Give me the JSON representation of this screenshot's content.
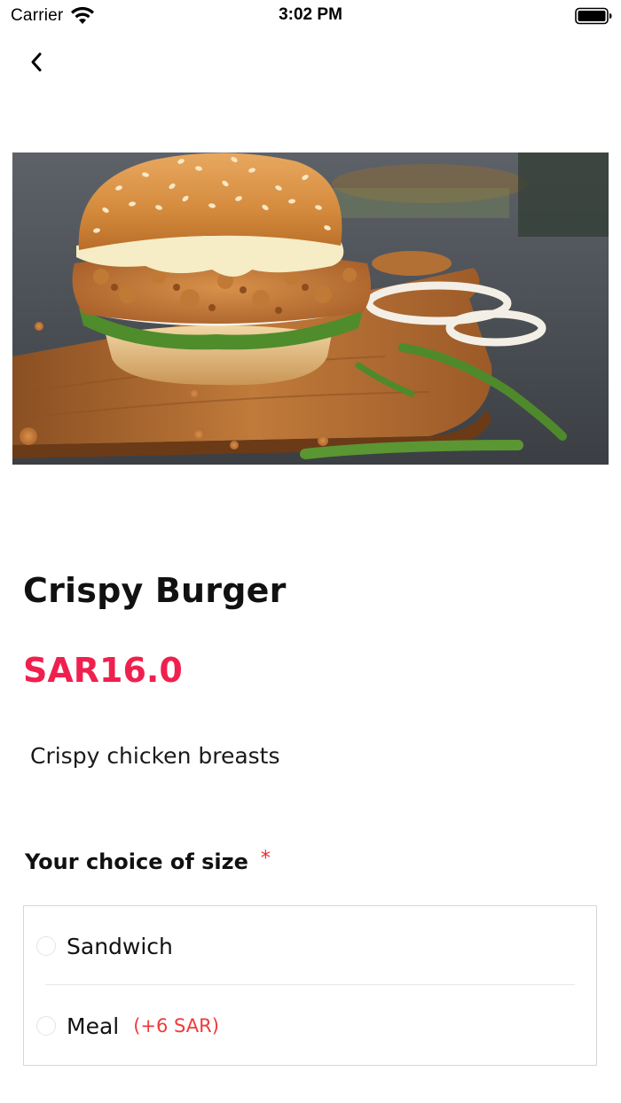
{
  "status_bar": {
    "carrier": "Carrier",
    "time": "3:02 PM"
  },
  "nav": {
    "back_icon": "chevron-left-icon"
  },
  "product": {
    "name": "Crispy Burger",
    "price": "SAR16.0",
    "description": "Crispy chicken breasts",
    "image_icon": "burger-photo"
  },
  "size_section": {
    "title": "Your choice of size",
    "required_mark": "*",
    "options": [
      {
        "label": "Sandwich",
        "extra": "",
        "selected": false
      },
      {
        "label": "Meal",
        "extra": "(+6 SAR)",
        "selected": false
      }
    ]
  },
  "colors": {
    "price": "#f0204e",
    "required": "#ef2b2b",
    "extra_price": "#ef3b3b",
    "border": "#d6d6d6"
  }
}
